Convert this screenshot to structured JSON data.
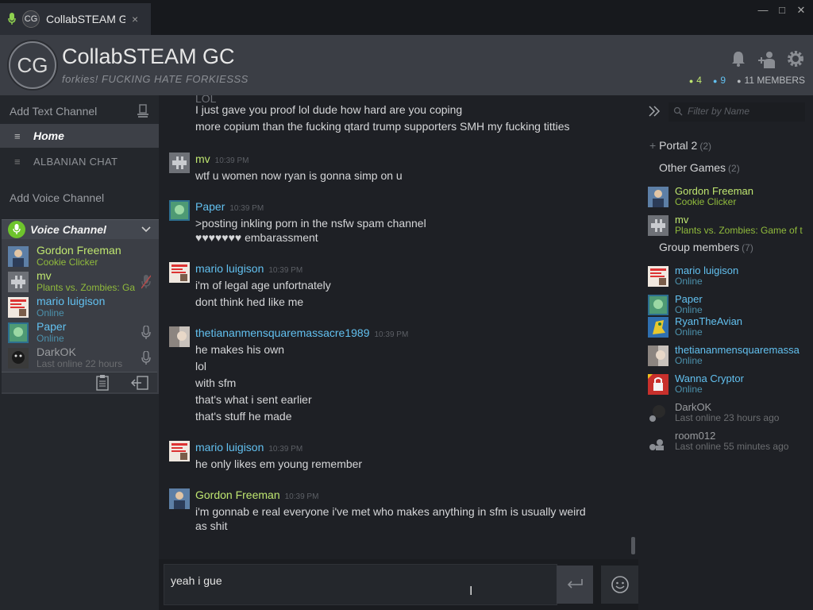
{
  "window": {
    "tab_title": "CollabSTEAM G",
    "tab_avatar": "CG",
    "close": "×",
    "controls": [
      "—",
      "□",
      "✕"
    ]
  },
  "header": {
    "avatar_text": "CG",
    "title": "CollabSTEAM GC",
    "subtitle": "forkies! FUCKING HATE FORKIESSS",
    "counts": {
      "ingame": "4",
      "online": "9",
      "members": "11 MEMBERS"
    },
    "icons": [
      "bell-icon",
      "add-friend-icon",
      "gear-icon"
    ]
  },
  "sidebar": {
    "add_text_channel": "Add Text Channel",
    "text_channels": [
      {
        "label": "Home",
        "active": true
      },
      {
        "label": "ALBANIAN CHAT",
        "active": false
      }
    ],
    "add_voice_channel": "Add Voice Channel",
    "voice_channel": {
      "title": "Voice Channel",
      "members": [
        {
          "name": "Gordon Freeman",
          "status": "Cookie Clicker",
          "state": "ingame"
        },
        {
          "name": "mv",
          "status": "Plants vs. Zombies: Ga",
          "state": "ingame"
        },
        {
          "name": "mario luigison",
          "status": "Online",
          "state": "online"
        },
        {
          "name": "Paper",
          "status": "Online",
          "state": "online"
        },
        {
          "name": "DarkOK",
          "status": "Last online 22 hours",
          "state": "offline"
        }
      ]
    }
  },
  "chat": {
    "groups": [
      {
        "author": "",
        "time": "",
        "lines": [
          "LOL",
          "I just gave you proof lol dude how hard are you coping",
          "more copium than the fucking qtard trump supporters SMH my fucking titties"
        ]
      },
      {
        "author": "mv",
        "time": "10:39 PM",
        "state": "ingame",
        "lines": [
          "wtf u women now ryan is gonna simp on u"
        ]
      },
      {
        "author": "Paper",
        "time": "10:39 PM",
        "state": "online",
        "lines": [
          ">posting inkling porn in the nsfw spam channel",
          "♥♥♥♥♥♥♥ embarassment"
        ]
      },
      {
        "author": "mario luigison",
        "time": "10:39 PM",
        "state": "online",
        "lines": [
          "i'm of legal age unfortnately",
          "dont think hed like me"
        ]
      },
      {
        "author": "thetiananmensquaremassacre1989",
        "time": "10:39 PM",
        "state": "online",
        "lines": [
          "he makes his own",
          "lol",
          "with sfm",
          "that's what i sent earlier",
          "that's stuff he made"
        ]
      },
      {
        "author": "mario luigison",
        "time": "10:39 PM",
        "state": "online",
        "lines": [
          "he only likes em young remember"
        ]
      },
      {
        "author": "Gordon Freeman",
        "time": "10:39 PM",
        "state": "ingame",
        "lines": [
          "i'm gonnab e real everyone i've met who makes anything in sfm is usually weird",
          "as shit"
        ]
      }
    ],
    "input_value": "yeah i gue"
  },
  "members_panel": {
    "filter_placeholder": "Filter by Name",
    "portal_group": {
      "label": "Portal 2",
      "count": "(2)"
    },
    "other_games": {
      "label": "Other Games",
      "count": "(2)"
    },
    "group_members": {
      "label": "Group members",
      "count": "(7)"
    },
    "ingame": [
      {
        "name": "Gordon Freeman",
        "status": "Cookie Clicker"
      },
      {
        "name": "mv",
        "status": "Plants vs. Zombies: Game of t"
      }
    ],
    "members": [
      {
        "name": "mario luigison",
        "status": "Online",
        "state": "online"
      },
      {
        "name": "Paper",
        "status": "Online",
        "state": "online"
      },
      {
        "name": "RyanTheAvian",
        "status": "Online",
        "state": "online"
      },
      {
        "name": "thetiananmensquaremassa",
        "status": "Online",
        "state": "online"
      },
      {
        "name": "Wanna Cryptor",
        "status": "Online",
        "state": "online"
      },
      {
        "name": "DarkOK",
        "status": "Last online 23 hours ago",
        "state": "offline"
      },
      {
        "name": "room012",
        "status": "Last online 55 minutes ago",
        "state": "offline"
      }
    ]
  },
  "colors": {
    "ingame": "#bfe670",
    "online": "#62c0ef",
    "offline": "#9a9c9f",
    "voice_active": "#50b427"
  }
}
